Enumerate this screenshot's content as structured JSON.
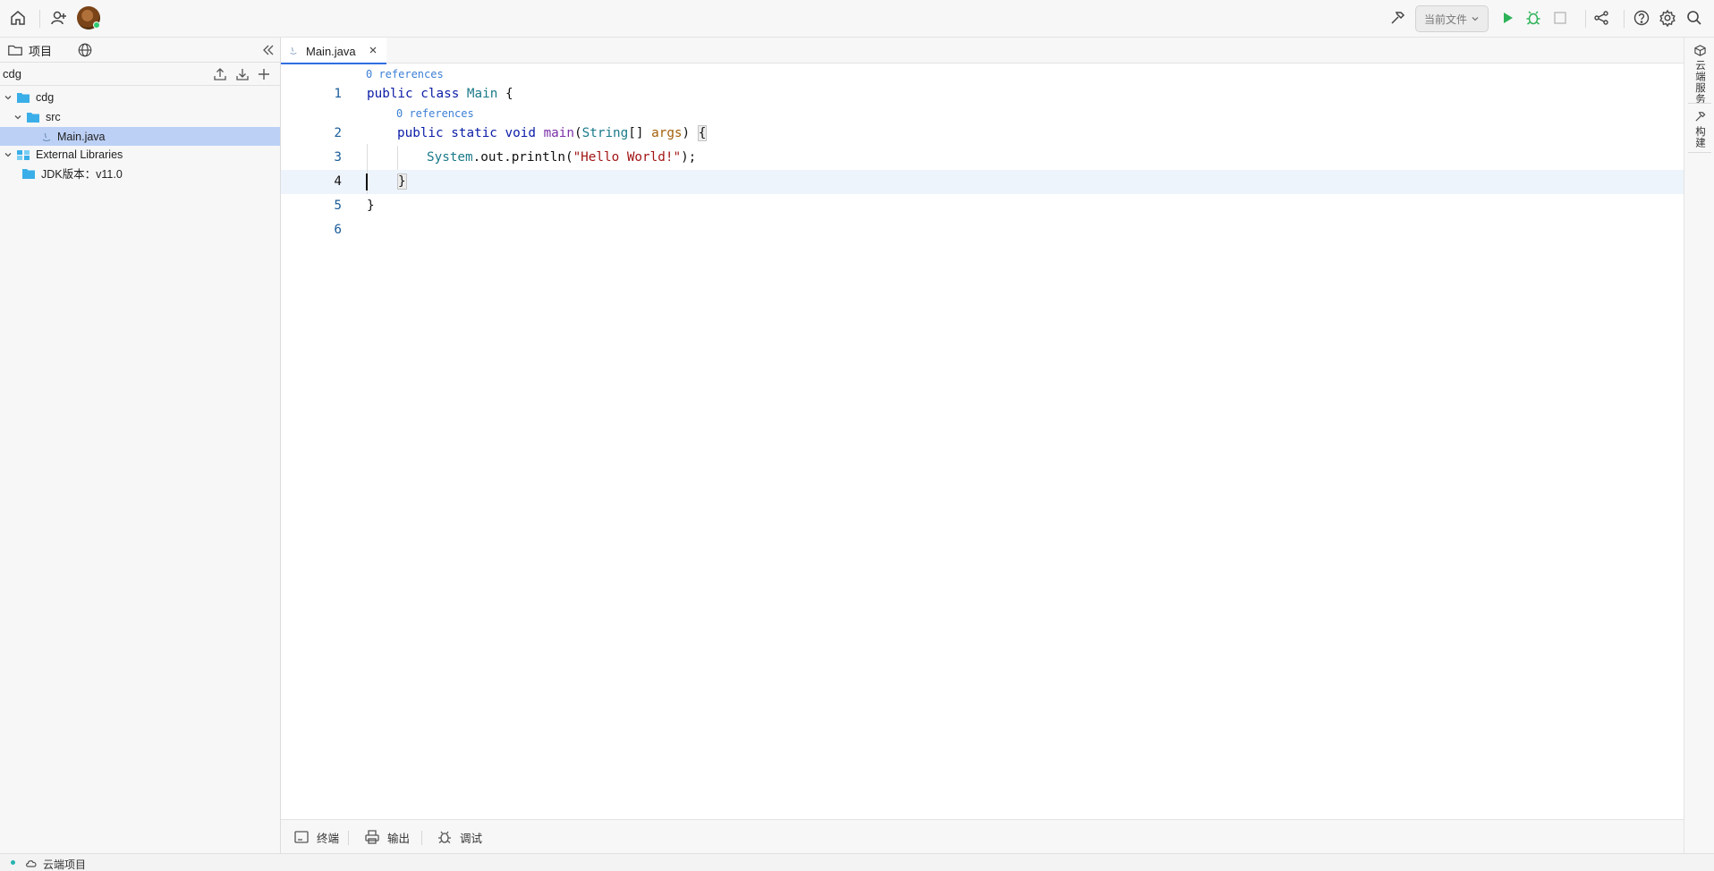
{
  "toolbar": {
    "icons": [
      "home-icon",
      "add-user-icon",
      "avatar",
      "hammer-icon",
      "run-icon",
      "debug-icon",
      "stop-icon",
      "share-icon",
      "help-icon",
      "gear-icon",
      "search-icon"
    ],
    "run_target": "当前文件",
    "colors": {
      "run": "#2db357",
      "debug": "#2db357",
      "stop_disabled": "#bdbdbd"
    }
  },
  "sidebar": {
    "tabs": [
      {
        "icon": "folder-icon",
        "label": "项目"
      },
      {
        "icon": "globe-icon",
        "label": ""
      }
    ],
    "project_name": "cdg",
    "tree": [
      {
        "label": "cdg",
        "type": "folder",
        "expanded": true,
        "depth": 0
      },
      {
        "label": "src",
        "type": "folder",
        "expanded": true,
        "depth": 1
      },
      {
        "label": "Main.java",
        "type": "java-file",
        "depth": 2,
        "selected": true
      },
      {
        "label": "External Libraries",
        "type": "library",
        "expanded": true,
        "depth": 0
      },
      {
        "label": "JDK版本：v11.0",
        "type": "folder",
        "depth": 1
      }
    ]
  },
  "editor": {
    "tabs": [
      {
        "label": "Main.java",
        "active": true
      }
    ],
    "references_label": "0 references",
    "lines": [
      {
        "num": "1"
      },
      {
        "num": "2"
      },
      {
        "num": "3"
      },
      {
        "num": "4"
      },
      {
        "num": "5"
      },
      {
        "num": "6"
      }
    ],
    "current_line": 4,
    "code": {
      "l1_public": "public",
      "l1_class": "class",
      "l1_name": "Main",
      "l1_brace": "{",
      "l2_public": "public",
      "l2_static": "static",
      "l2_void": "void",
      "l2_main": "main",
      "l2_open": "(",
      "l2_type": "String",
      "l2_arr": "[]",
      "l2_param": "args",
      "l2_close": ")",
      "l2_brace": "{",
      "l3_system": "System",
      "l3_rest": ".out.println(",
      "l3_string": "\"Hello World!\"",
      "l3_end": ");",
      "l4_brace": "}",
      "l5_brace": "}"
    }
  },
  "bottom_panel": {
    "items": [
      {
        "icon": "terminal-icon",
        "label": "终端"
      },
      {
        "icon": "printer-icon",
        "label": "输出"
      },
      {
        "icon": "bug-icon",
        "label": "调试"
      }
    ]
  },
  "right_strip": {
    "items": [
      {
        "icon": "cube-icon",
        "label": "云端服务"
      },
      {
        "icon": "hammer-icon",
        "label": "构建"
      }
    ]
  },
  "status": {
    "text": "云端项目"
  }
}
